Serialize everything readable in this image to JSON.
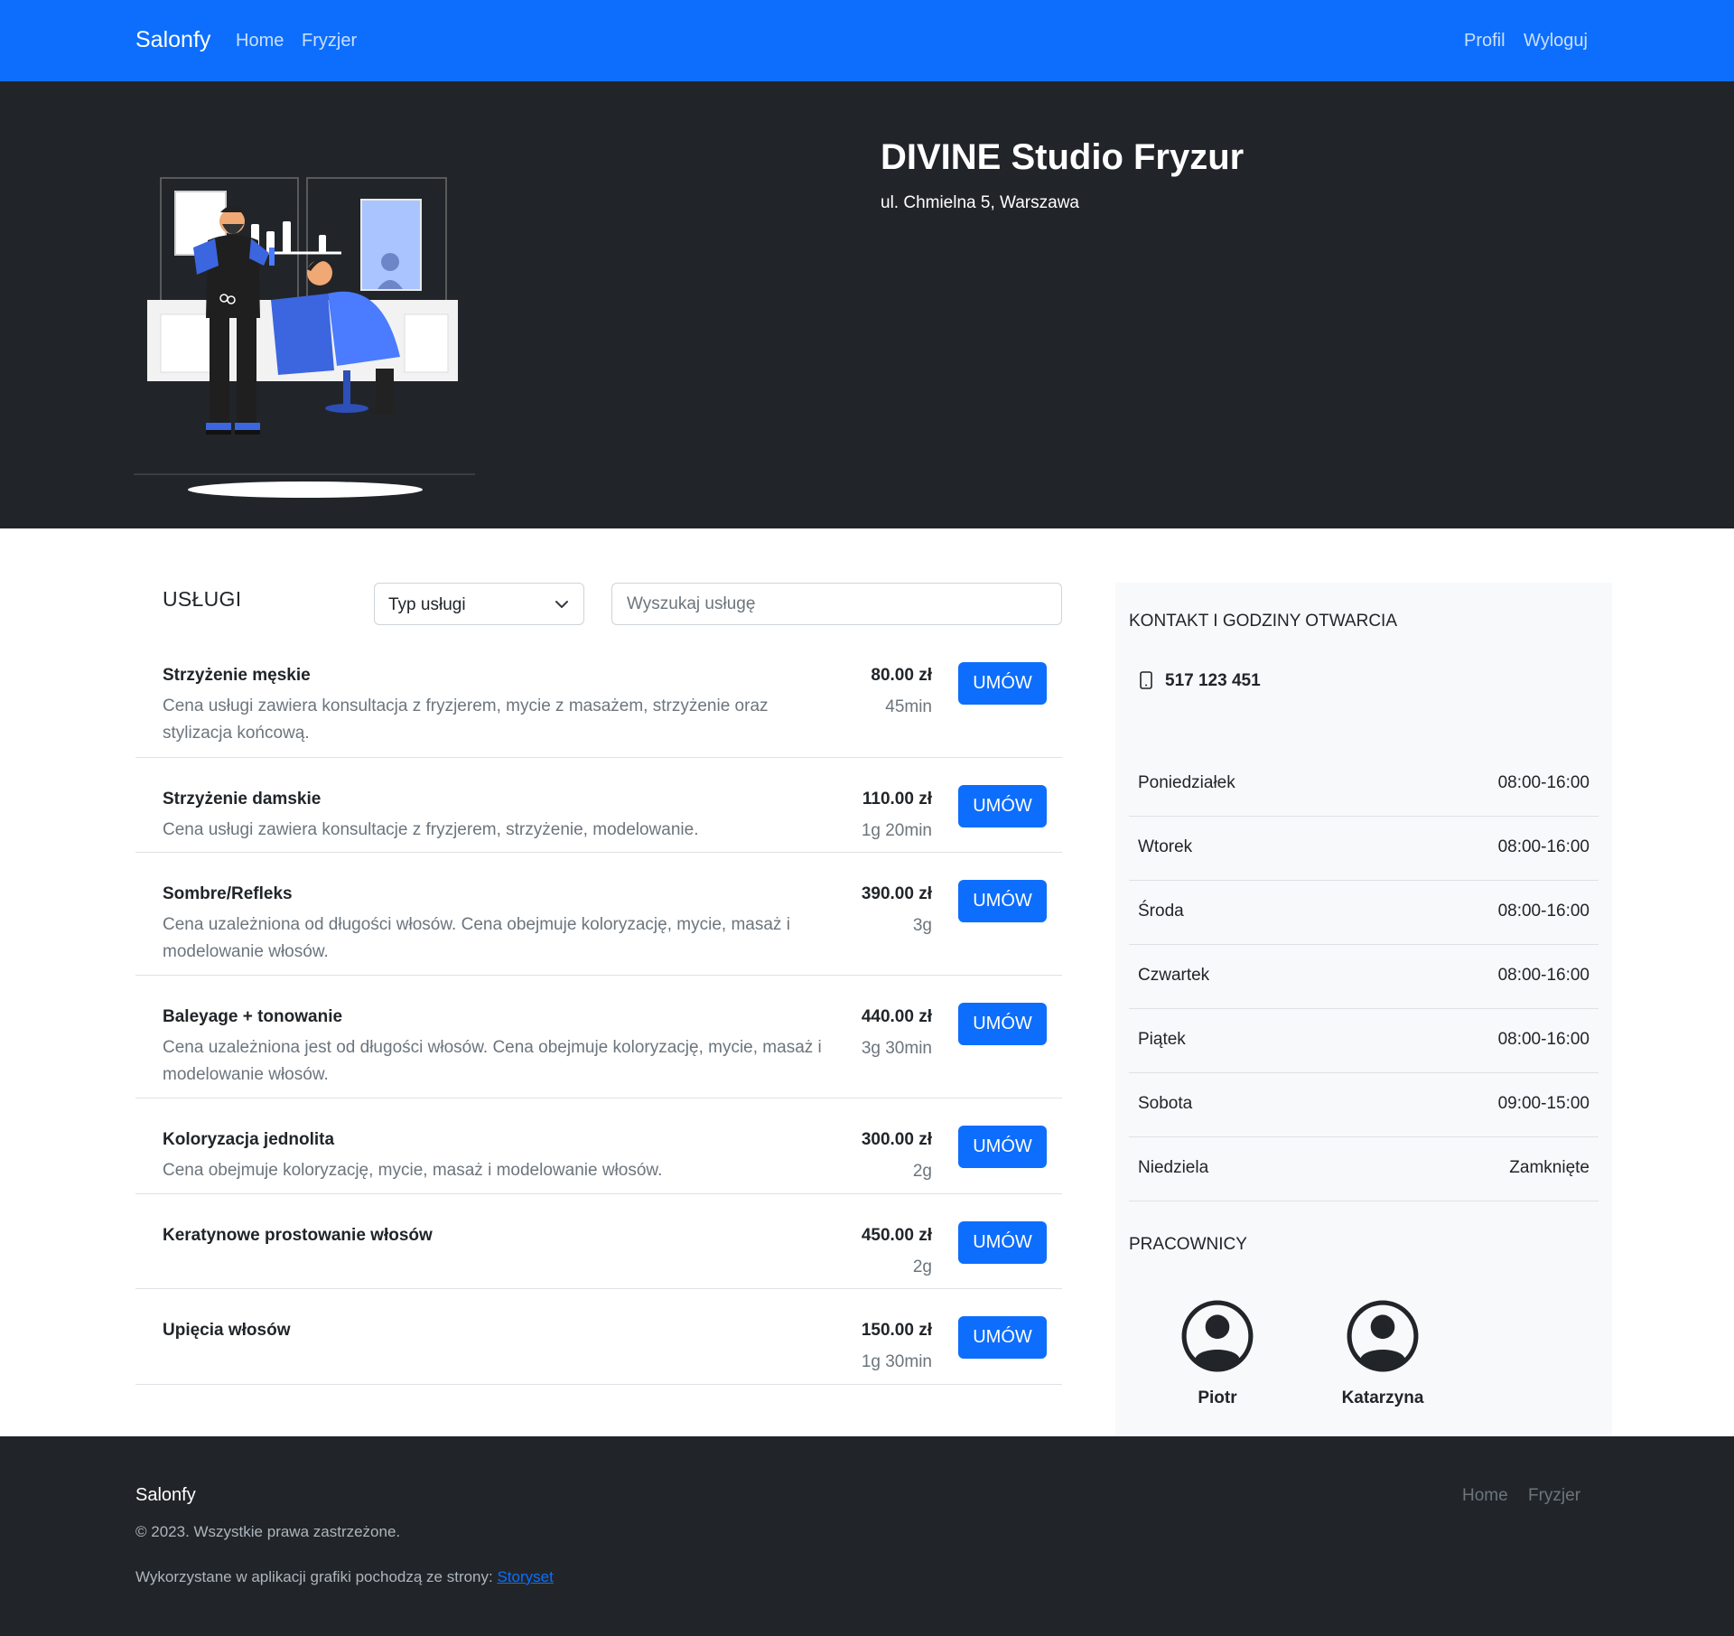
{
  "navbar": {
    "brand": "Salonfy",
    "links": [
      "Home",
      "Fryzjer"
    ],
    "right_links": [
      "Profil",
      "Wyloguj"
    ]
  },
  "hero": {
    "title": "DIVINE Studio Fryzur",
    "address": "ul. Chmielna 5, Warszawa"
  },
  "services": {
    "title": "USŁUGI",
    "type_select": "Typ usługi",
    "search_placeholder": "Wyszukaj usługę",
    "button_label": "UMÓW",
    "items": [
      {
        "name": "Strzyżenie męskie",
        "desc": "Cena usługi zawiera konsultacja z fryzjerem, mycie z masażem, strzyżenie oraz stylizacja końcową.",
        "price": "80.00 zł",
        "duration": "45min"
      },
      {
        "name": "Strzyżenie damskie",
        "desc": "Cena usługi zawiera konsultacje z fryzjerem, strzyżenie, modelowanie.",
        "price": "110.00 zł",
        "duration": "1g 20min"
      },
      {
        "name": "Sombre/Refleks",
        "desc": "Cena uzależniona od długości włosów. Cena obejmuje koloryzację, mycie, masaż i modelowanie włosów.",
        "price": "390.00 zł",
        "duration": "3g"
      },
      {
        "name": "Baleyage + tonowanie",
        "desc": "Cena uzależniona jest od długości włosów. Cena obejmuje koloryzację, mycie, masaż i modelowanie włosów.",
        "price": "440.00 zł",
        "duration": "3g 30min"
      },
      {
        "name": "Koloryzacja jednolita",
        "desc": "Cena obejmuje koloryzację, mycie, masaż i modelowanie włosów.",
        "price": "300.00 zł",
        "duration": "2g"
      },
      {
        "name": "Keratynowe prostowanie włosów",
        "desc": "",
        "price": "450.00 zł",
        "duration": "2g"
      },
      {
        "name": "Upięcia włosów",
        "desc": "",
        "price": "150.00 zł",
        "duration": "1g 30min"
      }
    ]
  },
  "contact": {
    "title": "KONTAKT I GODZINY OTWARCIA",
    "phone": "517 123 451",
    "hours": [
      {
        "day": "Poniedziałek",
        "time": "08:00-16:00"
      },
      {
        "day": "Wtorek",
        "time": "08:00-16:00"
      },
      {
        "day": "Środa",
        "time": "08:00-16:00"
      },
      {
        "day": "Czwartek",
        "time": "08:00-16:00"
      },
      {
        "day": "Piątek",
        "time": "08:00-16:00"
      },
      {
        "day": "Sobota",
        "time": "09:00-15:00"
      },
      {
        "day": "Niedziela",
        "time": "Zamknięte"
      }
    ]
  },
  "employees": {
    "title": "PRACOWNICY",
    "items": [
      "Piotr",
      "Katarzyna"
    ]
  },
  "footer": {
    "brand": "Salonfy",
    "copyright": "© 2023. Wszystkie prawa zastrzeżone.",
    "credit_text": "Wykorzystane w aplikacji grafiki pochodzą ze strony: ",
    "credit_link": "Storyset",
    "links": [
      "Home",
      "Fryzjer"
    ]
  },
  "colors": {
    "primary": "#0d6efd",
    "dark": "#212529",
    "light_bg": "#f8f9fa",
    "muted": "#6c757d"
  }
}
